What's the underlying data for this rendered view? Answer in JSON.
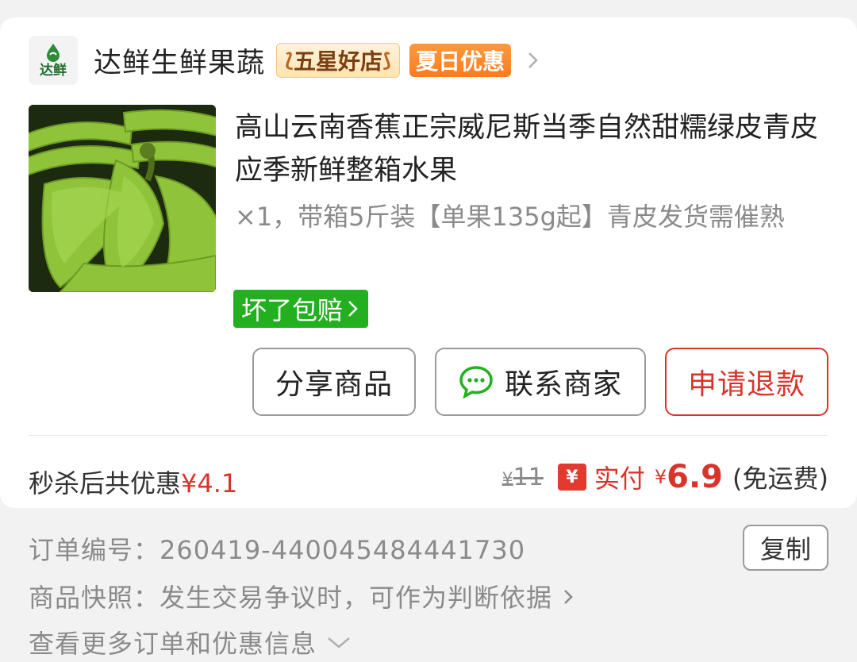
{
  "shop": {
    "logo_text": "达鲜",
    "name": "达鲜生鲜果蔬",
    "badge_star": "五星好店",
    "badge_summer": "夏日优惠"
  },
  "product": {
    "image_icon": "bananas-image",
    "title": "高山云南香蕉正宗威尼斯当季自然甜糯绿皮青皮应季新鲜整箱水果",
    "spec": "×1，带箱5斤装【单果135g起】青皮发货需催熟",
    "guarantee": "坏了包赔"
  },
  "actions": {
    "share": "分享商品",
    "contact": "联系商家",
    "refund": "申请退款"
  },
  "pricing": {
    "discount_label": "秒杀后共优惠",
    "discount_amount": "¥4.1",
    "original_currency": "¥",
    "original_price": "11",
    "paid_icon": "¥",
    "paid_label": "实付",
    "paid_currency": "¥",
    "paid_amount": "6.9",
    "shipping": "(免运费)"
  },
  "order": {
    "number_label": "订单编号：",
    "number": "260419-440045484441730",
    "copy": "复制",
    "snapshot_label": "商品快照：",
    "snapshot_text": "发生交易争议时，可作为判断依据",
    "more": "查看更多订单和优惠信息"
  },
  "colors": {
    "accent_red": "#d9342b",
    "guarantee_green": "#23b020",
    "summer_orange": "#ff7a1f"
  }
}
